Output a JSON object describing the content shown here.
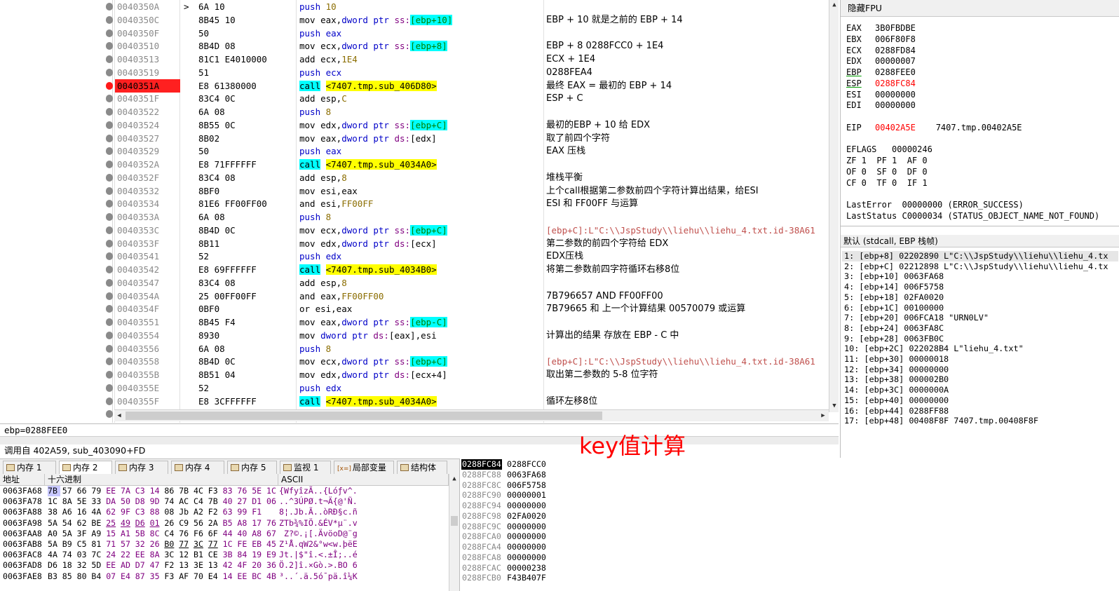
{
  "disasm": {
    "rows": [
      {
        "addr": "0040350A",
        "arrow": ">",
        "bytes": "6A 10",
        "instr": [
          [
            "kw",
            "push "
          ],
          [
            "num",
            "10"
          ]
        ],
        "comment": "",
        "bp": "gray"
      },
      {
        "addr": "0040350C",
        "bytes": "8B45 10",
        "instr": [
          [
            "",
            "mov eax,"
          ],
          [
            "kw",
            "dword ptr "
          ],
          [
            "seg",
            "ss:"
          ],
          [
            "brk",
            "[ebp+10]"
          ]
        ],
        "comment": "EBP + 10 就是之前的 EBP + 14",
        "bp": "gray"
      },
      {
        "addr": "0040350F",
        "bytes": "50",
        "instr": [
          [
            "kw",
            "push eax"
          ]
        ],
        "comment": "",
        "bp": "gray"
      },
      {
        "addr": "00403510",
        "bytes": "8B4D 08",
        "instr": [
          [
            "",
            "mov ecx,"
          ],
          [
            "kw",
            "dword ptr "
          ],
          [
            "seg",
            "ss:"
          ],
          [
            "brk",
            "[ebp+8]"
          ]
        ],
        "comment": "EBP + 8  0288FCC0 + 1E4",
        "bp": "gray"
      },
      {
        "addr": "00403513",
        "bytes": "81C1 E4010000",
        "instr": [
          [
            "",
            "add ecx,"
          ],
          [
            "num",
            "1E4"
          ]
        ],
        "comment": "ECX + 1E4",
        "bp": "gray"
      },
      {
        "addr": "00403519",
        "bytes": "51",
        "instr": [
          [
            "kw",
            "push ecx"
          ]
        ],
        "comment": "0288FEA4",
        "bp": "gray"
      },
      {
        "addr": "0040351A",
        "bytes": "E8 61380000",
        "instr": [
          [
            "call",
            "call"
          ],
          [
            "",
            " "
          ],
          [
            "tgt",
            "<7407.tmp.sub_406D80>"
          ]
        ],
        "comment": "最终 EAX =  最初的 EBP + 14",
        "bp": "red",
        "hl": true
      },
      {
        "addr": "0040351F",
        "bytes": "83C4 0C",
        "instr": [
          [
            "",
            "add esp,"
          ],
          [
            "num",
            "C"
          ]
        ],
        "comment": "ESP + C",
        "bp": "gray"
      },
      {
        "addr": "00403522",
        "bytes": "6A 08",
        "instr": [
          [
            "kw",
            "push "
          ],
          [
            "num",
            "8"
          ]
        ],
        "comment": "",
        "bp": "gray"
      },
      {
        "addr": "00403524",
        "bytes": "8B55 0C",
        "instr": [
          [
            "",
            "mov edx,"
          ],
          [
            "kw",
            "dword ptr "
          ],
          [
            "seg",
            "ss:"
          ],
          [
            "brk",
            "[ebp+C]"
          ]
        ],
        "comment": "最初的EBP + 10 给 EDX",
        "bp": "gray"
      },
      {
        "addr": "00403527",
        "bytes": "8B02",
        "instr": [
          [
            "",
            "mov eax,"
          ],
          [
            "kw",
            "dword ptr "
          ],
          [
            "seg",
            "ds:"
          ],
          [
            "",
            "[edx]"
          ]
        ],
        "comment": "取了前四个字符",
        "bp": "gray"
      },
      {
        "addr": "00403529",
        "bytes": "50",
        "instr": [
          [
            "kw",
            "push eax"
          ]
        ],
        "comment": "EAX 压栈",
        "bp": "gray"
      },
      {
        "addr": "0040352A",
        "bytes": "E8 71FFFFFF",
        "instr": [
          [
            "call",
            "call"
          ],
          [
            "",
            " "
          ],
          [
            "tgt",
            "<7407.tmp.sub_4034A0>"
          ]
        ],
        "comment": "",
        "bp": "gray"
      },
      {
        "addr": "0040352F",
        "bytes": "83C4 08",
        "instr": [
          [
            "",
            "add esp,"
          ],
          [
            "num",
            "8"
          ]
        ],
        "comment": "堆栈平衡",
        "bp": "gray"
      },
      {
        "addr": "00403532",
        "bytes": "8BF0",
        "instr": [
          [
            "",
            "mov esi,eax"
          ]
        ],
        "comment": "上个call根据第二参数前四个字符计算出结果，给ESI",
        "bp": "gray"
      },
      {
        "addr": "00403534",
        "bytes": "81E6 FF00FF00",
        "instr": [
          [
            "",
            "and esi,"
          ],
          [
            "num",
            "FF00FF"
          ]
        ],
        "comment": "ESI 和 FF00FF 与运算",
        "bp": "gray"
      },
      {
        "addr": "0040353A",
        "bytes": "6A 08",
        "instr": [
          [
            "kw",
            "push "
          ],
          [
            "num",
            "8"
          ]
        ],
        "comment": "",
        "bp": "gray"
      },
      {
        "addr": "0040353C",
        "bytes": "8B4D 0C",
        "instr": [
          [
            "",
            "mov ecx,"
          ],
          [
            "kw",
            "dword ptr "
          ],
          [
            "seg",
            "ss:"
          ],
          [
            "brk",
            "[ebp+C]"
          ]
        ],
        "comment": "[ebp+C]:L\"C:\\\\JspStudy\\\\liehu\\\\liehu_4.txt.id-38A61",
        "cbr": true,
        "bp": "gray"
      },
      {
        "addr": "0040353F",
        "bytes": "8B11",
        "instr": [
          [
            "",
            "mov edx,"
          ],
          [
            "kw",
            "dword ptr "
          ],
          [
            "seg",
            "ds:"
          ],
          [
            "",
            "[ecx]"
          ]
        ],
        "comment": "第二参数的前四个字符给 EDX",
        "bp": "gray"
      },
      {
        "addr": "00403541",
        "bytes": "52",
        "instr": [
          [
            "kw",
            "push edx"
          ]
        ],
        "comment": "EDX压栈",
        "bp": "gray"
      },
      {
        "addr": "00403542",
        "bytes": "E8 69FFFFFF",
        "instr": [
          [
            "call",
            "call"
          ],
          [
            "",
            " "
          ],
          [
            "tgt",
            "<7407.tmp.sub_4034B0>"
          ]
        ],
        "comment": "将第二参数前四字符循环右移8位",
        "bp": "gray"
      },
      {
        "addr": "00403547",
        "bytes": "83C4 08",
        "instr": [
          [
            "",
            "add esp,"
          ],
          [
            "num",
            "8"
          ]
        ],
        "comment": "",
        "bp": "gray"
      },
      {
        "addr": "0040354A",
        "bytes": "25 00FF00FF",
        "instr": [
          [
            "",
            "and eax,"
          ],
          [
            "num",
            "FF00FF00"
          ]
        ],
        "comment": "7B796657 AND FF00FF00",
        "bp": "gray"
      },
      {
        "addr": "0040354F",
        "bytes": "0BF0",
        "instr": [
          [
            "",
            "or esi,eax"
          ]
        ],
        "comment": "7B79665 和 上一个计算结果 00570079  或运算",
        "bp": "gray"
      },
      {
        "addr": "00403551",
        "bytes": "8B45 F4",
        "instr": [
          [
            "",
            "mov eax,"
          ],
          [
            "kw",
            "dword ptr "
          ],
          [
            "seg",
            "ss:"
          ],
          [
            "brk",
            "[ebp-C]"
          ]
        ],
        "comment": "",
        "bp": "gray"
      },
      {
        "addr": "00403554",
        "bytes": "8930",
        "instr": [
          [
            "",
            "mov "
          ],
          [
            "kw",
            "dword ptr "
          ],
          [
            "seg",
            "ds:"
          ],
          [
            "",
            "[eax],esi"
          ]
        ],
        "comment": "计算出的结果 存放在  EBP - C 中",
        "bp": "gray"
      },
      {
        "addr": "00403556",
        "bytes": "6A 08",
        "instr": [
          [
            "kw",
            "push "
          ],
          [
            "num",
            "8"
          ]
        ],
        "comment": "",
        "bp": "gray"
      },
      {
        "addr": "00403558",
        "bytes": "8B4D 0C",
        "instr": [
          [
            "",
            "mov ecx,"
          ],
          [
            "kw",
            "dword ptr "
          ],
          [
            "seg",
            "ss:"
          ],
          [
            "brk",
            "[ebp+C]"
          ]
        ],
        "comment": "[ebp+C]:L\"C:\\\\JspStudy\\\\liehu\\\\liehu_4.txt.id-38A61",
        "cbr": true,
        "bp": "gray"
      },
      {
        "addr": "0040355B",
        "bytes": "8B51 04",
        "instr": [
          [
            "",
            "mov edx,"
          ],
          [
            "kw",
            "dword ptr "
          ],
          [
            "seg",
            "ds:"
          ],
          [
            "",
            "[ecx+4]"
          ]
        ],
        "comment": "取出第二参数的 5-8 位字符",
        "bp": "gray"
      },
      {
        "addr": "0040355E",
        "bytes": "52",
        "instr": [
          [
            "kw",
            "push edx"
          ]
        ],
        "comment": "",
        "bp": "gray"
      },
      {
        "addr": "0040355F",
        "bytes": "E8 3CFFFFFF",
        "instr": [
          [
            "call",
            "call"
          ],
          [
            "",
            " "
          ],
          [
            "tgt",
            "<7407.tmp.sub_4034A0>"
          ]
        ],
        "comment": "循环左移8位",
        "bp": "gray"
      },
      {
        "addr": "00403564",
        "bytes": "83C4 08",
        "instr": [
          [
            "",
            "add esp,"
          ],
          [
            "num",
            "8"
          ]
        ],
        "comment": "",
        "bp": "gray"
      }
    ]
  },
  "info": {
    "line1": "ebp=0288FEE0",
    "line2": "调用自  402A59, sub_403090+FD",
    "annotation": "key值计算"
  },
  "registers": {
    "title": "隐藏FPU",
    "gpr": [
      {
        "name": "EAX",
        "value": "3B0FBDBE"
      },
      {
        "name": "EBX",
        "value": "006F80F8"
      },
      {
        "name": "ECX",
        "value": "0288FD84"
      },
      {
        "name": "EDX",
        "value": "00000007"
      },
      {
        "name": "EBP",
        "value": "0288FEE0",
        "ul": true
      },
      {
        "name": "ESP",
        "value": "0288FC84",
        "ul": true,
        "red": true
      },
      {
        "name": "ESI",
        "value": "00000000"
      },
      {
        "name": "EDI",
        "value": "00000000"
      }
    ],
    "eip": {
      "name": "EIP",
      "value": "00402A5E",
      "label": "7407.tmp.00402A5E"
    },
    "eflags": "EFLAGS   00000246",
    "flags": [
      "ZF 1  PF 1  AF 0",
      "OF 0  SF 0  DF 0",
      "CF 0  TF 0  IF 1"
    ],
    "last_error": "LastError  00000000 (ERROR_SUCCESS)",
    "last_status": "LastStatus C0000034 (STATUS_OBJECT_NAME_NOT_FOUND)"
  },
  "stack_args": {
    "header": "默认 (stdcall, EBP 栈帧)",
    "rows": [
      "1: [ebp+8] 02202890 L\"C:\\\\JspStudy\\\\liehu\\\\liehu_4.tx",
      "2: [ebp+C] 02212898 L\"C:\\\\JspStudy\\\\liehu\\\\liehu_4.tx",
      "3: [ebp+10] 0063FA68",
      "4: [ebp+14] 006F5758",
      "5: [ebp+18] 02FA0020",
      "6: [ebp+1C] 00100000",
      "7: [ebp+20] 006FCA18 \"URN0LV\"",
      "8: [ebp+24] 0063FA8C",
      "9: [ebp+28] 0063FB0C",
      "10: [ebp+2C] 022028B4 L\"liehu_4.txt\"",
      "11: [ebp+30] 00000018",
      "12: [ebp+34] 00000000",
      "13: [ebp+38] 000002B0",
      "14: [ebp+3C] 0000000A",
      "15: [ebp+40] 00000000",
      "16: [ebp+44] 0288FF88",
      "17: [ebp+48] 00408F8F 7407.tmp.00408F8F"
    ]
  },
  "tabs": [
    {
      "label": "内存 1",
      "icon": "memory-icon"
    },
    {
      "label": "内存 2",
      "icon": "memory-icon",
      "active": true
    },
    {
      "label": "内存 3",
      "icon": "memory-icon"
    },
    {
      "label": "内存 4",
      "icon": "memory-icon"
    },
    {
      "label": "内存 5",
      "icon": "memory-icon"
    },
    {
      "label": "监视 1",
      "icon": "watch-icon"
    },
    {
      "label": "局部变量",
      "icon": "locals-icon",
      "prefix": "[x=]"
    },
    {
      "label": "结构体",
      "icon": "struct-icon"
    }
  ],
  "dump": {
    "col_addr": "地址",
    "col_hex": "十六进制",
    "col_ascii": "ASCII",
    "rows": [
      {
        "addr": "0063FA68",
        "hex": [
          "7B",
          "57",
          "66",
          "79",
          "EE",
          "7A",
          "C3",
          "14",
          "86",
          "7B",
          "4C",
          "F3",
          "83",
          "76",
          "5E",
          "1C"
        ],
        "ascii": "{WfyîzÃ..{Lóƒv^."
      },
      {
        "addr": "0063FA78",
        "hex": [
          "1C",
          "8A",
          "5E",
          "33",
          "DA",
          "50",
          "D8",
          "9D",
          "74",
          "AC",
          "C4",
          "7B",
          "40",
          "27",
          "D1",
          "06"
        ],
        "ascii": "..^3ÚPØ.t¬Ä{@'Ñ."
      },
      {
        "addr": "0063FA88",
        "hex": [
          "38",
          "A6",
          "16",
          "4A",
          "62",
          "9F",
          "C3",
          "88",
          "08",
          "Jb",
          "A2",
          "F2",
          "63",
          "99",
          "F1",
          ""
        ],
        "ascii": "8¦.Jb.Ã..òRÐ§c.ñ"
      },
      {
        "addr": "0063FA98",
        "hex": [
          "5A",
          "54",
          "62",
          "BE",
          "25",
          "49",
          "D6",
          "01",
          "26",
          "C9",
          "56",
          "2A",
          "B5",
          "A8",
          "17",
          "76"
        ],
        "ascii": "ZTb¾%IÖ.&ÉV*µ¨.v"
      },
      {
        "addr": "0063FAA8",
        "hex": [
          "A0",
          "5A",
          "3F",
          "A9",
          "15",
          "A1",
          "5B",
          "8C",
          "C4",
          "76",
          "F6",
          "6F",
          "44",
          "40",
          "A8",
          "67"
        ],
        "ascii": " Z?©.¡[.ÄvöoD@¨g"
      },
      {
        "addr": "0063FAB8",
        "hex": [
          "5A",
          "B9",
          "C5",
          "81",
          "71",
          "57",
          "32",
          "26",
          "B0",
          "77",
          "3C",
          "77",
          "1C",
          "FE",
          "EB",
          "45"
        ],
        "ascii": "Z¹Å.qW2&°w<w.þëE"
      },
      {
        "addr": "0063FAC8",
        "hex": [
          "4A",
          "74",
          "03",
          "7C",
          "24",
          "22",
          "EE",
          "8A",
          "3C",
          "12",
          "B1",
          "CE",
          "3B",
          "84",
          "19",
          "E9"
        ],
        "ascii": "Jt.|$\"î.<.±Î;..é"
      },
      {
        "addr": "0063FAD8",
        "hex": [
          "D6",
          "18",
          "32",
          "5D",
          "EE",
          "AD",
          "D7",
          "47",
          "F2",
          "13",
          "3E",
          "13",
          "42",
          "4F",
          "20",
          "36"
        ],
        "ascii": "Ö.2]î.×Gò.>.BO 6"
      },
      {
        "addr": "0063FAE8",
        "hex": [
          "B3",
          "85",
          "80",
          "B4",
          "07",
          "E4",
          "87",
          "35",
          "F3",
          "AF",
          "70",
          "E4",
          "14",
          "EE",
          "BC",
          "4B"
        ],
        "ascii": "³..´.ä.5ó¯pä.î¼K"
      }
    ]
  },
  "small_stack": {
    "rows": [
      {
        "addr": "0288FC84",
        "value": "0288FCC0"
      },
      {
        "addr": "0288FC88",
        "value": "0063FA68"
      },
      {
        "addr": "0288FC8C",
        "value": "006F5758"
      },
      {
        "addr": "0288FC90",
        "value": "00000001"
      },
      {
        "addr": "0288FC94",
        "value": "00000000"
      },
      {
        "addr": "0288FC98",
        "value": "02FA0020"
      },
      {
        "addr": "0288FC9C",
        "value": "00000000"
      },
      {
        "addr": "0288FCA0",
        "value": "00000000"
      },
      {
        "addr": "0288FCA4",
        "value": "00000000"
      },
      {
        "addr": "0288FCA8",
        "value": "00000000"
      },
      {
        "addr": "0288FCAC",
        "value": "00000238"
      },
      {
        "addr": "0288FCB0",
        "value": "F43B407F"
      }
    ]
  },
  "colors": {
    "breakpoint": "#ff1a1a",
    "call_bg": "#00ffff",
    "target_bg": "#ffff00",
    "annotation": "#ff0000"
  }
}
